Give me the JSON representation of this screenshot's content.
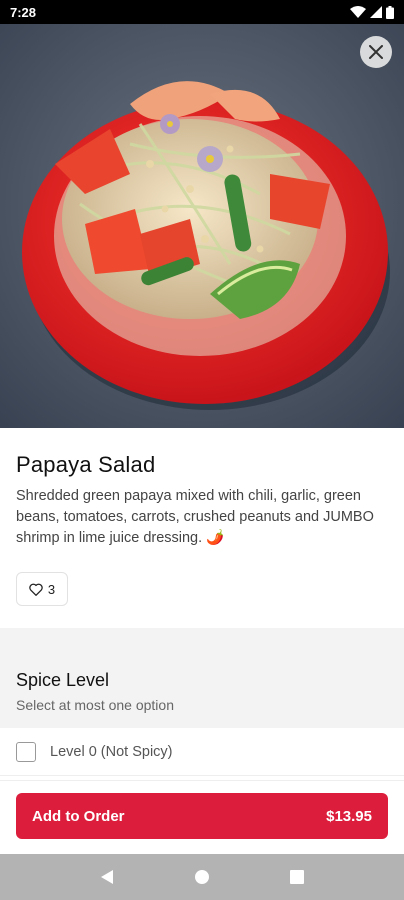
{
  "status_bar": {
    "time": "7:28"
  },
  "product": {
    "title": "Papaya Salad",
    "description": "Shredded green papaya mixed with chili, garlic, green beans, tomatoes, carrots, crushed peanuts and JUMBO shrimp in lime juice dressing. 🌶️",
    "likes": "3"
  },
  "spice_section": {
    "title": "Spice Level",
    "subtitle": "Select at most one option",
    "options": [
      {
        "label": "Level 0 (Not Spicy)",
        "checked": false
      }
    ]
  },
  "order": {
    "button_label": "Add to Order",
    "price": "$13.95"
  },
  "icons": {
    "close": "close-icon",
    "heart": "heart-icon",
    "nav_back": "back-triangle-icon",
    "nav_home": "home-circle-icon",
    "nav_recents": "recents-square-icon"
  },
  "colors": {
    "accent": "#dc1e3c",
    "plate": "#e41e24"
  }
}
